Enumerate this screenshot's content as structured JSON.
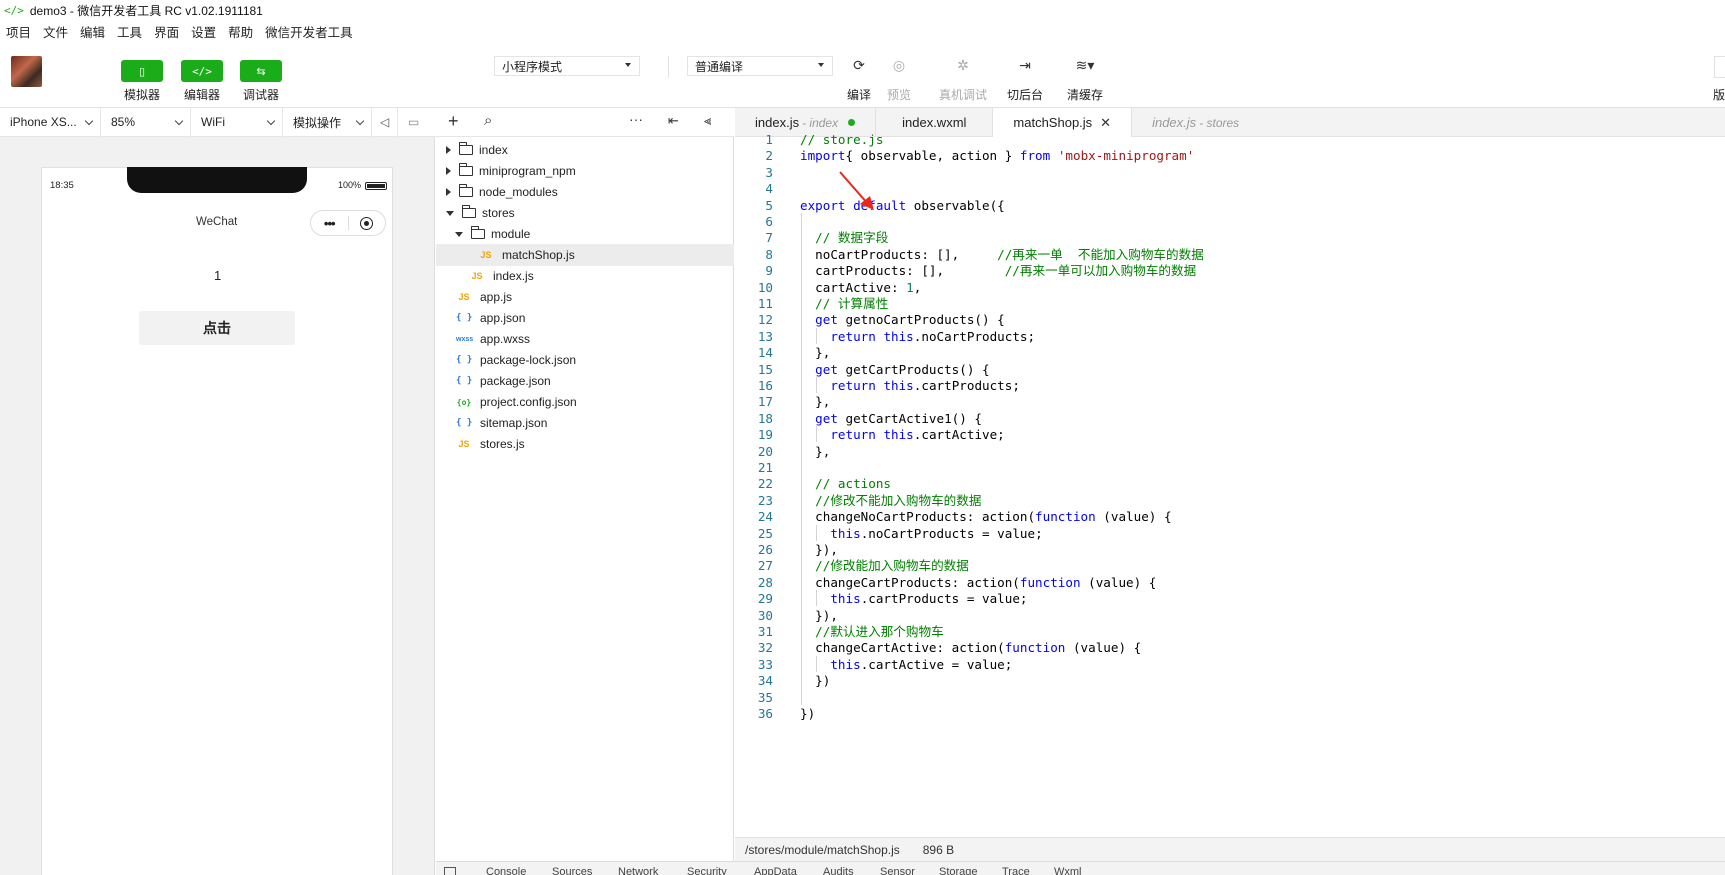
{
  "window": {
    "title": "demo3 - 微信开发者工具 RC v1.02.1911181"
  },
  "menu": [
    "项目",
    "文件",
    "编辑",
    "工具",
    "界面",
    "设置",
    "帮助",
    "微信开发者工具"
  ],
  "toolbar": {
    "simulator": "模拟器",
    "editor": "编辑器",
    "debugger": "调试器",
    "mode_select": "小程序模式",
    "compile_select": "普通编译",
    "compile": "编译",
    "preview": "预览",
    "real_debug": "真机调试",
    "background": "切后台",
    "clear_cache": "清缓存",
    "version": "版"
  },
  "devbar": {
    "device": "iPhone XS...",
    "zoom": "85%",
    "network": "WiFi",
    "simulate": "模拟操作"
  },
  "phone": {
    "time": "18:35",
    "battery": "100%",
    "nav_title": "WeChat",
    "value": "1",
    "button": "点击"
  },
  "tree": [
    {
      "name": "index",
      "type": "folder",
      "open": false,
      "depth": 0
    },
    {
      "name": "miniprogram_npm",
      "type": "folder",
      "open": false,
      "depth": 0
    },
    {
      "name": "node_modules",
      "type": "folder",
      "open": false,
      "depth": 0
    },
    {
      "name": "stores",
      "type": "folder",
      "open": true,
      "depth": 0
    },
    {
      "name": "module",
      "type": "folder",
      "open": true,
      "depth": 1
    },
    {
      "name": "matchShop.js",
      "type": "js",
      "depth": 2,
      "selected": true
    },
    {
      "name": "index.js",
      "type": "js",
      "depth": 1
    },
    {
      "name": "app.js",
      "type": "js",
      "depth": 0
    },
    {
      "name": "app.json",
      "type": "json",
      "depth": 0
    },
    {
      "name": "app.wxss",
      "type": "wxss",
      "depth": 0
    },
    {
      "name": "package-lock.json",
      "type": "json",
      "depth": 0
    },
    {
      "name": "package.json",
      "type": "json",
      "depth": 0
    },
    {
      "name": "project.config.json",
      "type": "cfg",
      "depth": 0
    },
    {
      "name": "sitemap.json",
      "type": "json",
      "depth": 0
    },
    {
      "name": "stores.js",
      "type": "js",
      "depth": 0
    }
  ],
  "tabs": [
    {
      "name": "index.js",
      "sub": "- index",
      "modified": true
    },
    {
      "name": "index.wxml"
    },
    {
      "name": "matchShop.js",
      "active": true,
      "closable": true
    },
    {
      "name": "index.js",
      "sub": "- stores",
      "italic": true
    }
  ],
  "code": [
    [
      [
        "com",
        "// store.js"
      ]
    ],
    [
      [
        "kw",
        "import"
      ],
      [
        "",
        "{ observable, action } "
      ],
      [
        "kw",
        "from"
      ],
      [
        "",
        " "
      ],
      [
        "str",
        "'mobx-miniprogram'"
      ]
    ],
    [],
    [],
    [
      [
        "kw",
        "export"
      ],
      [
        "",
        " "
      ],
      [
        "kw",
        "default"
      ],
      [
        "",
        " observable({"
      ]
    ],
    [],
    [
      [
        "",
        "  "
      ],
      [
        "com",
        "// 数据字段"
      ]
    ],
    [
      [
        "",
        "  noCartProducts: [],     "
      ],
      [
        "com",
        "//再来一单  不能加入购物车的数据"
      ]
    ],
    [
      [
        "",
        "  cartProducts: [],        "
      ],
      [
        "com",
        "//再来一单可以加入购物车的数据"
      ]
    ],
    [
      [
        "",
        "  cartActive: "
      ],
      [
        "num",
        "1"
      ],
      [
        "",
        ","
      ]
    ],
    [
      [
        "",
        "  "
      ],
      [
        "com",
        "// 计算属性"
      ]
    ],
    [
      [
        "",
        "  "
      ],
      [
        "kw",
        "get"
      ],
      [
        "",
        " getnoCartProducts() {"
      ]
    ],
    [
      [
        "",
        "    "
      ],
      [
        "kw",
        "return"
      ],
      [
        "",
        " "
      ],
      [
        "kw",
        "this"
      ],
      [
        "",
        ".noCartProducts;"
      ]
    ],
    [
      [
        "",
        "  },"
      ]
    ],
    [
      [
        "",
        "  "
      ],
      [
        "kw",
        "get"
      ],
      [
        "",
        " getCartProducts() {"
      ]
    ],
    [
      [
        "",
        "    "
      ],
      [
        "kw",
        "return"
      ],
      [
        "",
        " "
      ],
      [
        "kw",
        "this"
      ],
      [
        "",
        ".cartProducts;"
      ]
    ],
    [
      [
        "",
        "  },"
      ]
    ],
    [
      [
        "",
        "  "
      ],
      [
        "kw",
        "get"
      ],
      [
        "",
        " getCartActive1() {"
      ]
    ],
    [
      [
        "",
        "    "
      ],
      [
        "kw",
        "return"
      ],
      [
        "",
        " "
      ],
      [
        "kw",
        "this"
      ],
      [
        "",
        ".cartActive;"
      ]
    ],
    [
      [
        "",
        "  },"
      ]
    ],
    [],
    [
      [
        "",
        "  "
      ],
      [
        "com",
        "// actions"
      ]
    ],
    [
      [
        "",
        "  "
      ],
      [
        "com",
        "//修改不能加入购物车的数据"
      ]
    ],
    [
      [
        "",
        "  changeNoCartProducts: action("
      ],
      [
        "kw",
        "function"
      ],
      [
        "",
        " (value) {"
      ]
    ],
    [
      [
        "",
        "    "
      ],
      [
        "kw",
        "this"
      ],
      [
        "",
        ".noCartProducts = value;"
      ]
    ],
    [
      [
        "",
        "  }),"
      ]
    ],
    [
      [
        "",
        "  "
      ],
      [
        "com",
        "//修改能加入购物车的数据"
      ]
    ],
    [
      [
        "",
        "  changeCartProducts: action("
      ],
      [
        "kw",
        "function"
      ],
      [
        "",
        " (value) {"
      ]
    ],
    [
      [
        "",
        "    "
      ],
      [
        "kw",
        "this"
      ],
      [
        "",
        ".cartProducts = value;"
      ]
    ],
    [
      [
        "",
        "  }),"
      ]
    ],
    [
      [
        "",
        "  "
      ],
      [
        "com",
        "//默认进入那个购物车"
      ]
    ],
    [
      [
        "",
        "  changeCartActive: action("
      ],
      [
        "kw",
        "function"
      ],
      [
        "",
        " (value) {"
      ]
    ],
    [
      [
        "",
        "    "
      ],
      [
        "kw",
        "this"
      ],
      [
        "",
        ".cartActive = value;"
      ]
    ],
    [
      [
        "",
        "  })"
      ]
    ],
    [],
    [
      [
        "",
        "})"
      ]
    ]
  ],
  "status": {
    "path": "/stores/module/matchShop.js",
    "size": "896 B"
  },
  "bottom_tabs": [
    "Console",
    "Sources",
    "Network",
    "Security",
    "AppData",
    "Audits",
    "Sensor",
    "Storage",
    "Trace",
    "Wxml"
  ]
}
